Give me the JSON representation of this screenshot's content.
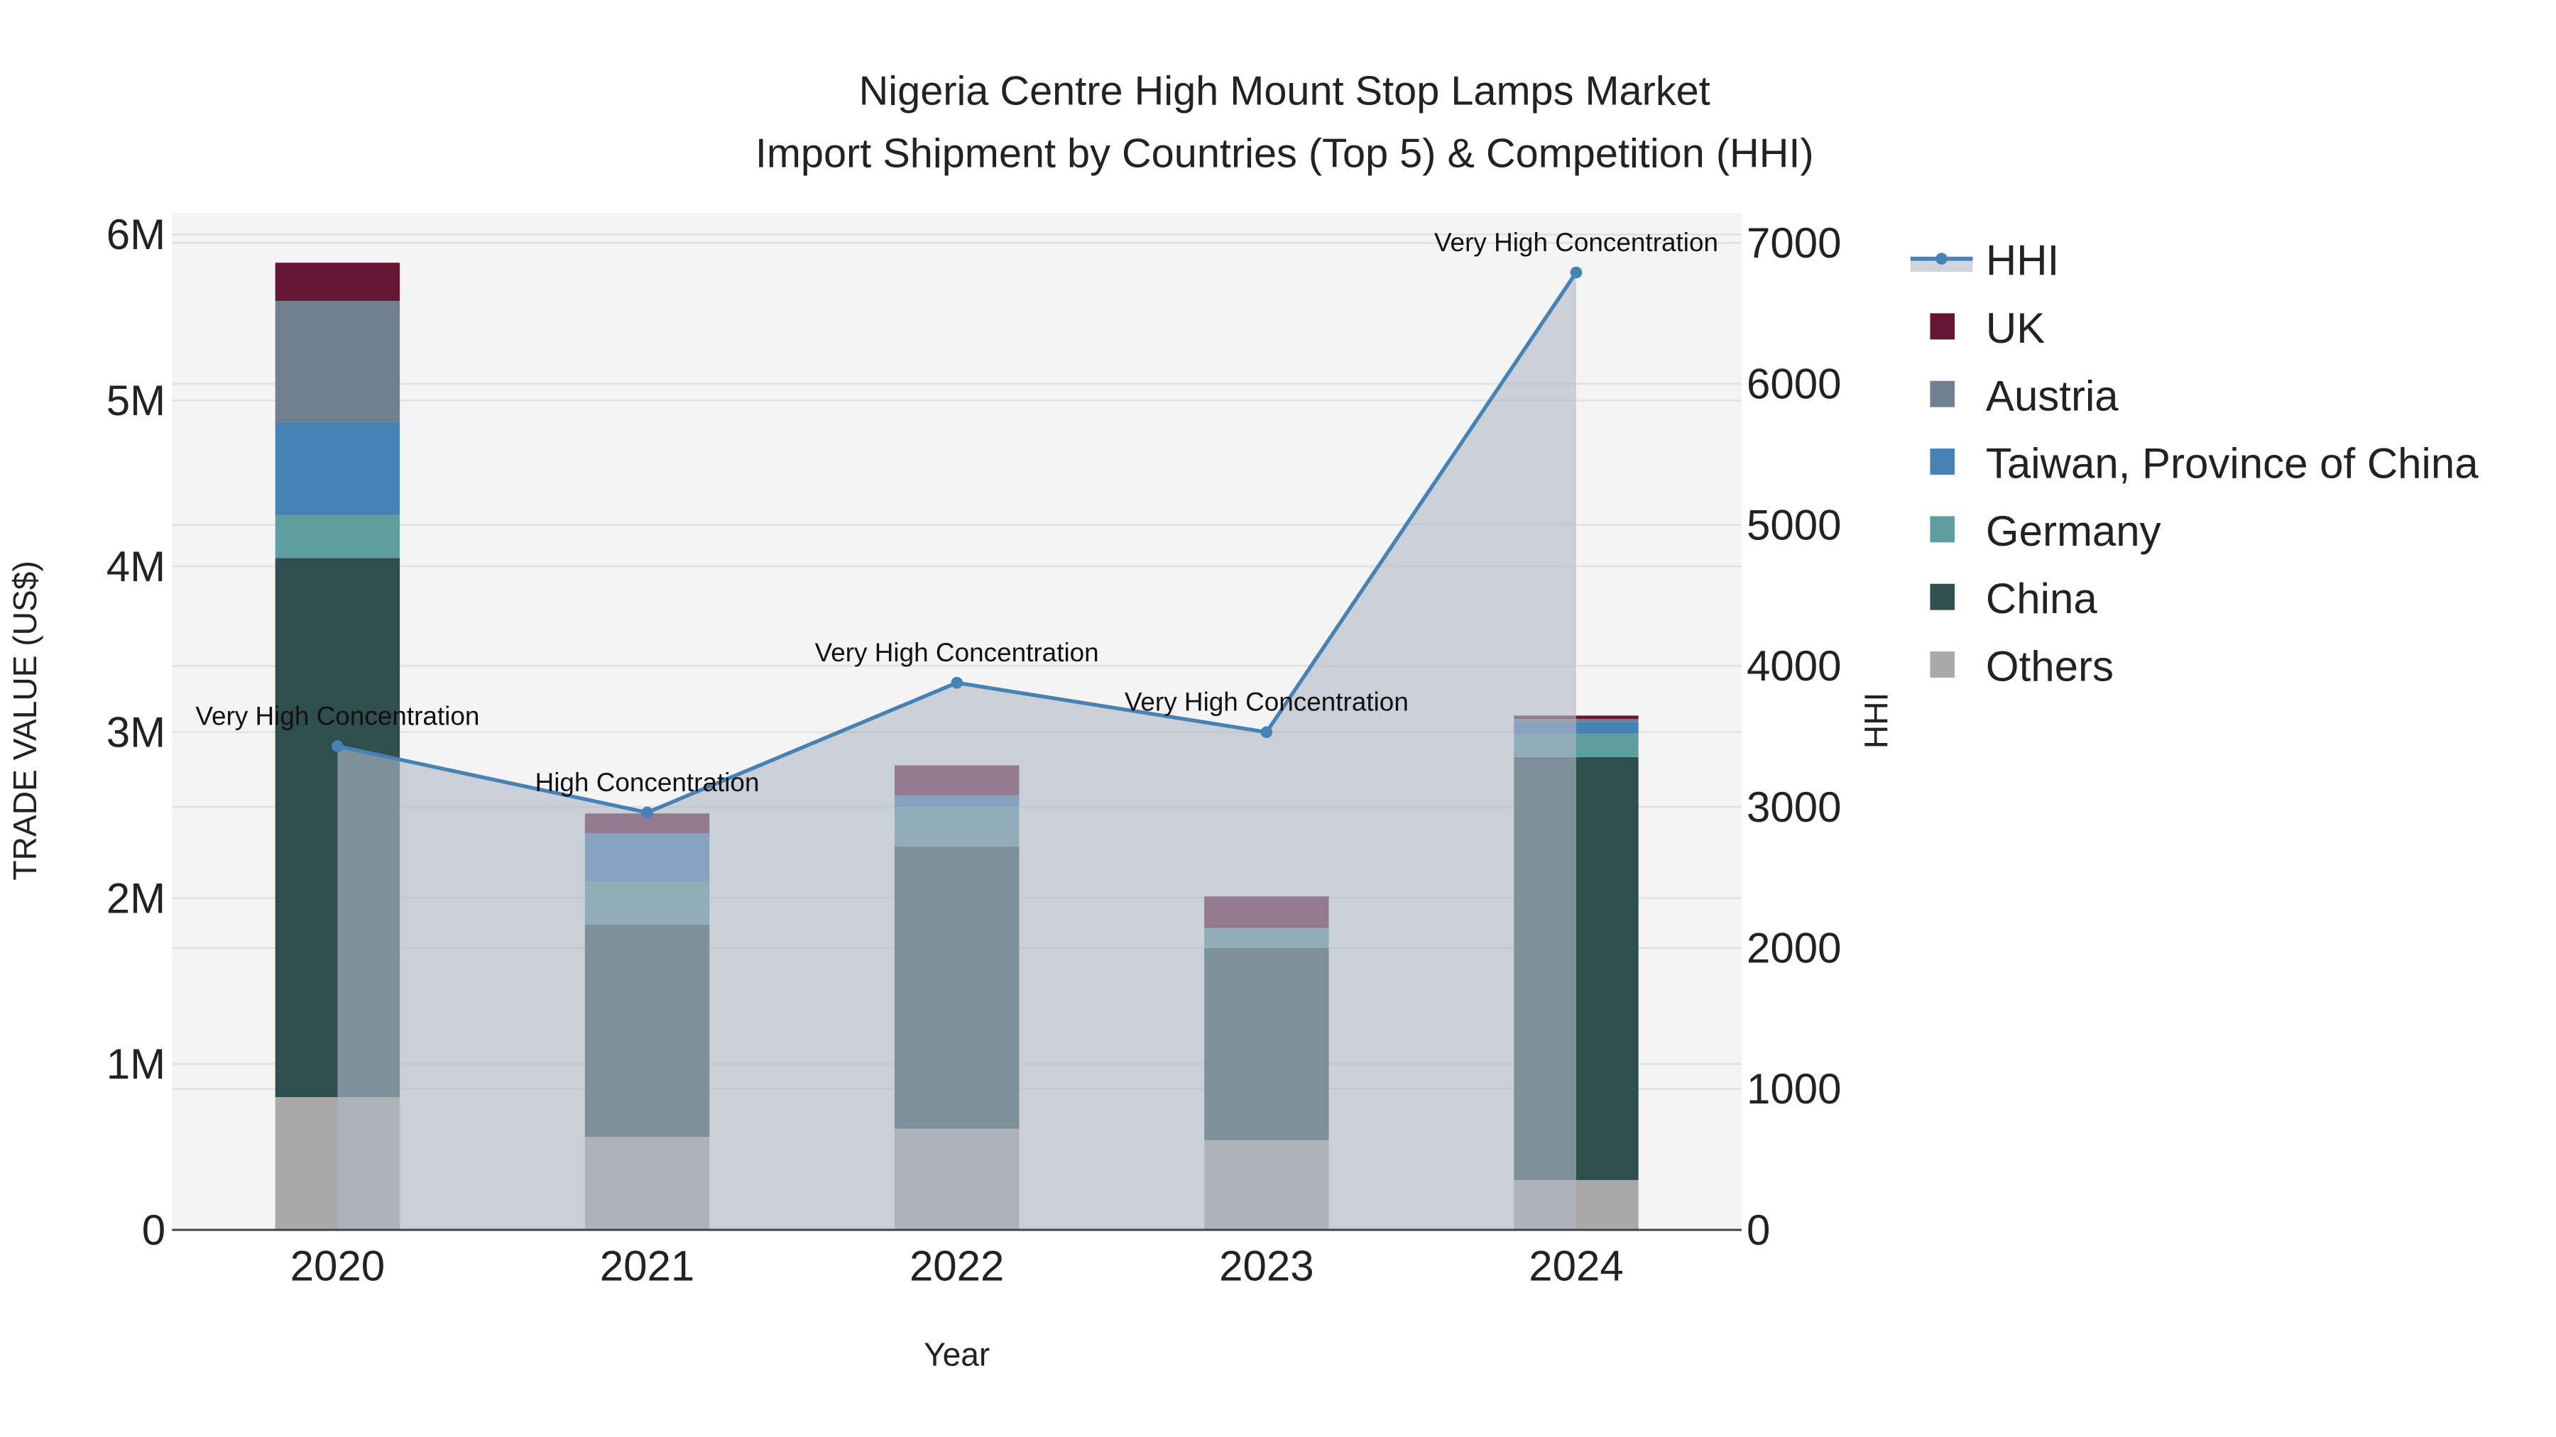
{
  "chart_data": {
    "type": "bar",
    "title": "Nigeria Centre High Mount Stop Lamps Market",
    "subtitle": "Import Shipment by Countries (Top 5) & Competition (HHI)",
    "xlabel": "Year",
    "ylabel": "TRADE VALUE (US$)",
    "y2label": "HHI",
    "categories": [
      "2020",
      "2021",
      "2022",
      "2023",
      "2024"
    ],
    "ylim": [
      0,
      6100000
    ],
    "y2lim": [
      0,
      7200
    ],
    "yticks": [
      {
        "v": 0,
        "label": "0"
      },
      {
        "v": 1000000,
        "label": "1M"
      },
      {
        "v": 2000000,
        "label": "2M"
      },
      {
        "v": 3000000,
        "label": "3M"
      },
      {
        "v": 4000000,
        "label": "4M"
      },
      {
        "v": 5000000,
        "label": "5M"
      },
      {
        "v": 6000000,
        "label": "6M"
      }
    ],
    "y2ticks": [
      0,
      1000,
      2000,
      3000,
      4000,
      5000,
      6000,
      7000
    ],
    "stacked": true,
    "series": [
      {
        "name": "Others",
        "color": "#a9a9a9",
        "values": [
          800000,
          560000,
          610000,
          540000,
          300000
        ]
      },
      {
        "name": "China",
        "color": "#2f4f4f",
        "values": [
          3250000,
          1280000,
          1700000,
          1160000,
          2550000
        ]
      },
      {
        "name": "Germany",
        "color": "#5f9ea0",
        "values": [
          260000,
          260000,
          240000,
          120000,
          140000
        ]
      },
      {
        "name": "Taiwan, Province of China",
        "color": "#4682b4",
        "values": [
          560000,
          290000,
          70000,
          0,
          70000
        ]
      },
      {
        "name": "Austria",
        "color": "#708090",
        "values": [
          730000,
          0,
          0,
          0,
          20000
        ]
      },
      {
        "name": "UK",
        "color": "#641634",
        "values": [
          230000,
          120000,
          180000,
          190000,
          20000
        ]
      }
    ],
    "line": {
      "name": "HHI",
      "color": "#4682b4",
      "values": [
        3430,
        2960,
        3880,
        3530,
        6790
      ],
      "annotations": [
        "Very High Concentration",
        "High Concentration",
        "Very High Concentration",
        "Very High Concentration",
        "Very High Concentration"
      ]
    },
    "legend_order": [
      "HHI",
      "UK",
      "Austria",
      "Taiwan, Province of China",
      "Germany",
      "China",
      "Others"
    ],
    "legend_position": "right"
  }
}
